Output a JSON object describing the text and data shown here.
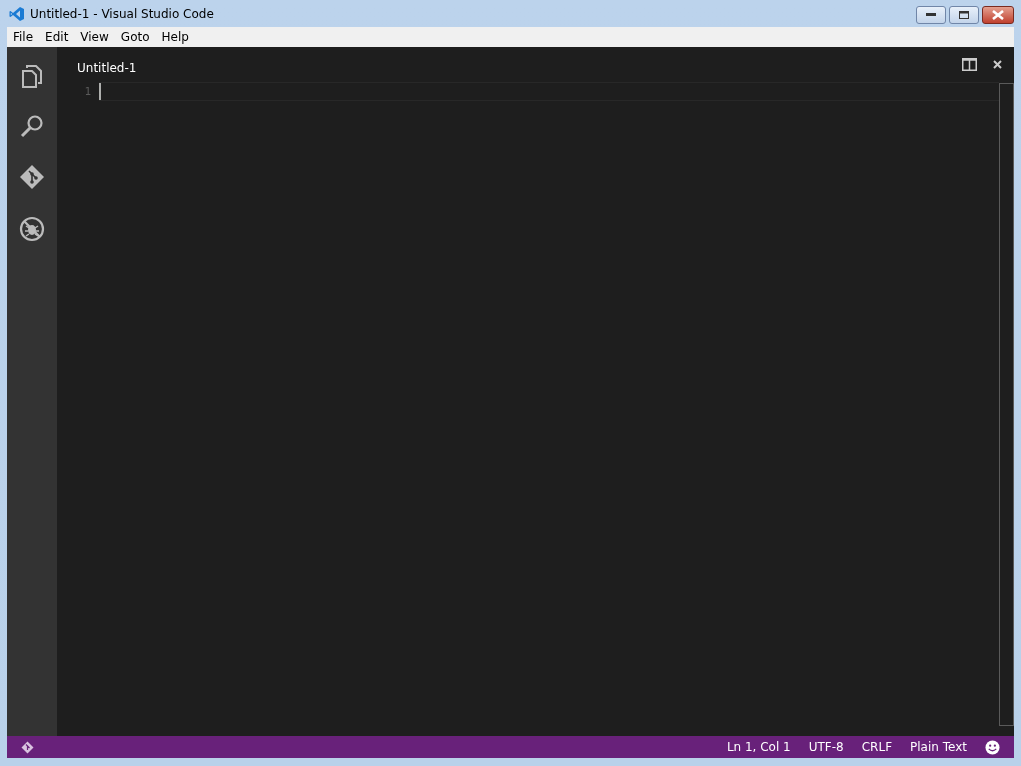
{
  "window": {
    "title": "Untitled-1 - Visual Studio Code"
  },
  "menu": [
    "File",
    "Edit",
    "View",
    "Goto",
    "Help"
  ],
  "activity_bar": [
    {
      "kind": "files"
    },
    {
      "kind": "search"
    },
    {
      "kind": "git"
    },
    {
      "kind": "debug"
    }
  ],
  "editor": {
    "tab": "Untitled-1",
    "line_numbers": [
      "1"
    ]
  },
  "status_bar": {
    "items": [
      "Ln 1, Col 1",
      "UTF-8",
      "CRLF",
      "Plain Text"
    ]
  }
}
